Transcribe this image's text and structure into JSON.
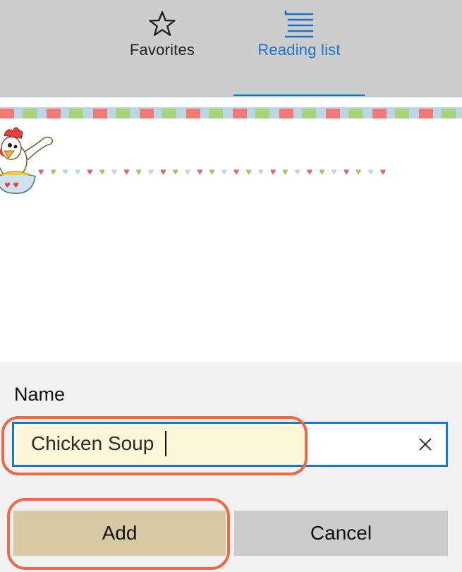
{
  "tabs": {
    "favorites": {
      "label": "Favorites",
      "icon": "star-outline-icon"
    },
    "reading_list": {
      "label": "Reading list",
      "icon": "reading-list-icon",
      "active": true
    }
  },
  "webpage": {
    "images": [
      "chicken-chef-cartoon"
    ],
    "decor": {
      "stripe_colors": [
        "#f07a76",
        "#bcd6e6",
        "#a9d27a"
      ],
      "heart_colors": [
        "#ef5f66",
        "#9ccd5c",
        "#bcd6e6"
      ]
    }
  },
  "dialog": {
    "name_label": "Name",
    "name_value": "Chicken Soup",
    "clear_icon": "close-icon",
    "add_label": "Add",
    "cancel_label": "Cancel"
  },
  "colors": {
    "accent": "#1a73c8",
    "highlight_ring": "#ec6a46",
    "input_highlight": "#fdf6d8",
    "add_button": "#d6c9a4",
    "cancel_button": "#cccccc"
  }
}
